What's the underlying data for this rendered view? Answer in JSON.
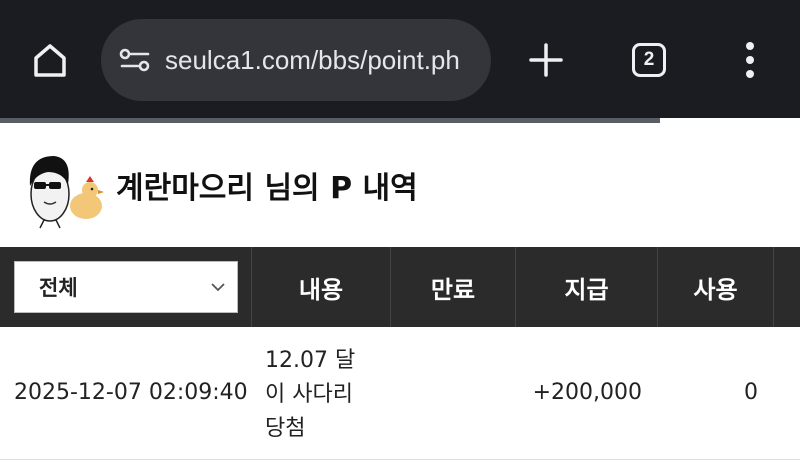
{
  "browser": {
    "url": "seulca1.com/bbs/point.ph",
    "tab_count": "2",
    "icons": {
      "home": "home-icon",
      "site_info": "site-settings-icon",
      "new_tab": "plus-icon",
      "tabs": "tab-switcher-icon",
      "menu": "more-vert-icon"
    },
    "colors": {
      "bar": "#1b1c21",
      "url_pill": "#34353b"
    }
  },
  "page": {
    "title": "계란마으리 님의 P 내역"
  },
  "table": {
    "filter": {
      "selected": "전체"
    },
    "headers": {
      "content": "내용",
      "expiry": "만료",
      "paid": "지급",
      "used": "사용"
    },
    "rows": [
      {
        "date": "2025-12-07 02:09:40",
        "content_lines": [
          "12.07 달",
          "이 사다리",
          "당첨"
        ],
        "expiry": "",
        "paid": "+200,000",
        "used": "0"
      }
    ],
    "colors": {
      "header_bg": "#2b2b2b",
      "header_text": "#ffffff"
    }
  }
}
